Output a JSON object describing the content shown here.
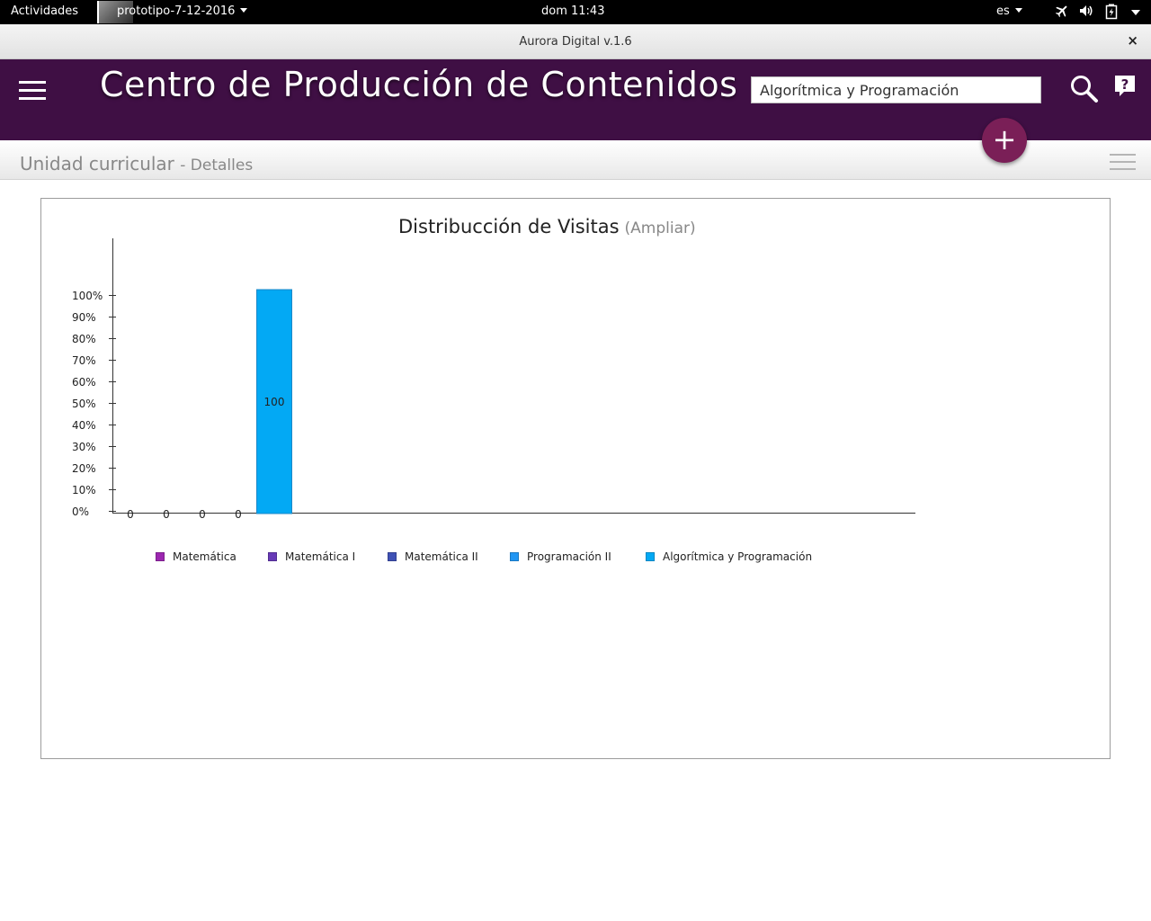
{
  "system_bar": {
    "activities": "Actividades",
    "app_name": "prototipo-7-12-2016",
    "clock": "dom 11:43",
    "language": "es",
    "tray_icons": [
      "airplane-mode-icon",
      "volume-icon",
      "battery-icon",
      "power-menu-caret-icon"
    ]
  },
  "window": {
    "title": "Aurora Digital v.1.6",
    "close_label": "×"
  },
  "header": {
    "title": "Centro de Producción de Contenidos",
    "search_value": "Algorítmica y Programación",
    "menu_icon": "hamburger-menu-icon",
    "search_icon": "search-icon",
    "help_icon": "help-icon",
    "add_icon": "plus-icon",
    "background_color": "#3f0f44",
    "fab_color": "#7a1f57"
  },
  "subheader": {
    "title": "Unidad curricular",
    "detail": "- Detalles",
    "menu_icon": "hamburger-menu-icon"
  },
  "chart": {
    "title": "Distribucción de Visitas",
    "expand_link": "(Ampliar)"
  },
  "chart_data": {
    "type": "bar",
    "title": "Distribucción de Visitas",
    "categories": [
      "Matemática",
      "Matemática I",
      "Matemática II",
      "Programación II",
      "Algorítmica y Programación"
    ],
    "values": [
      0,
      0,
      0,
      0,
      100
    ],
    "data_labels": [
      "0",
      "0",
      "0",
      "0",
      "100"
    ],
    "colors": [
      "#9c27b0",
      "#673ab7",
      "#3f51b5",
      "#2196f3",
      "#03a9f4"
    ],
    "yticks": [
      "0%",
      "10%",
      "20%",
      "30%",
      "40%",
      "50%",
      "60%",
      "70%",
      "80%",
      "90%",
      "100%"
    ],
    "ylim": [
      0,
      100
    ],
    "grid": false,
    "legend": "bottom"
  }
}
